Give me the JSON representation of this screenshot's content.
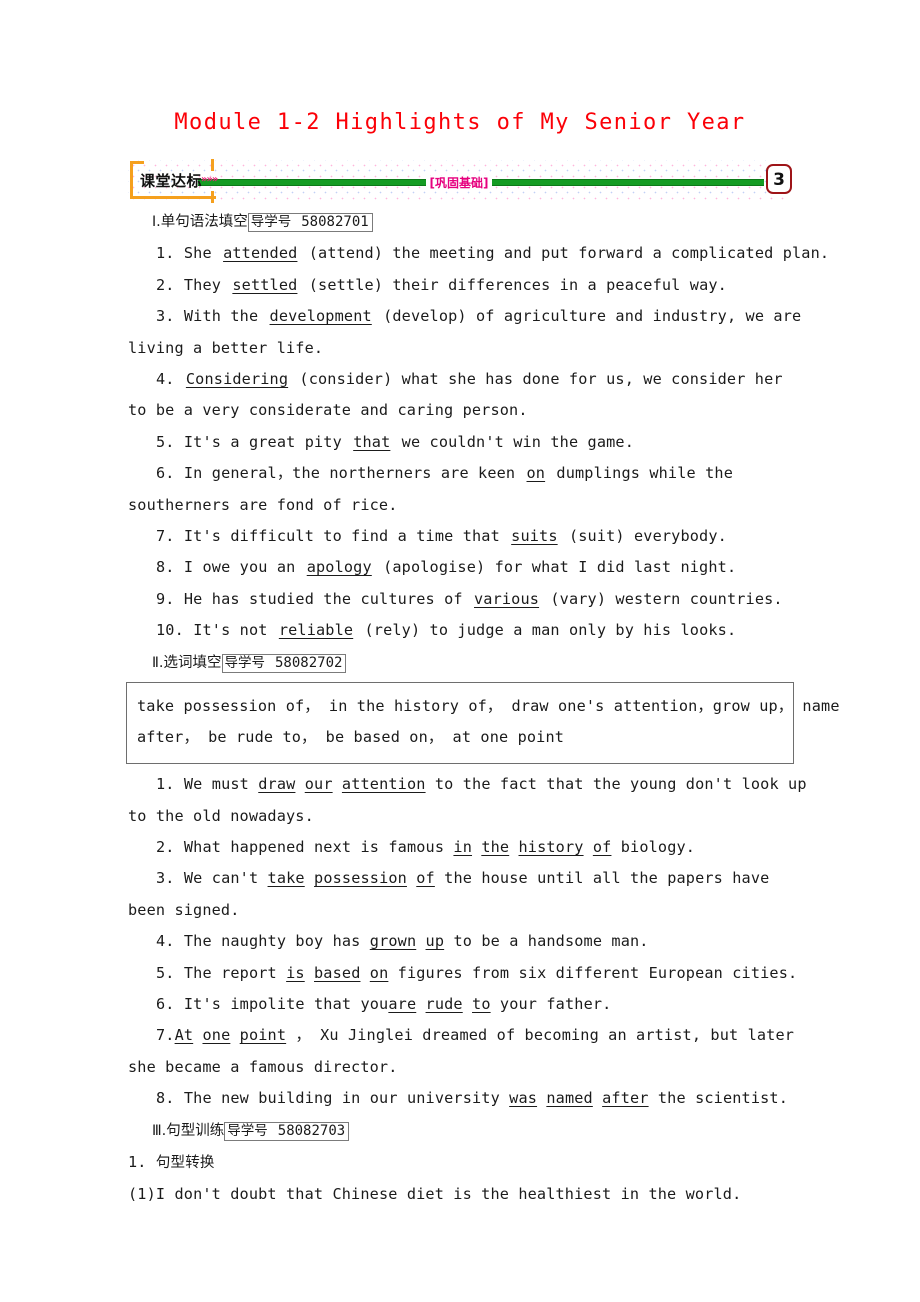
{
  "document": {
    "title": "Module 1-2 Highlights of My Senior Year",
    "title_color": "#fb0007"
  },
  "banner": {
    "label": "课堂达标",
    "chevrons": "»»»",
    "center_label": "[巩固基础]",
    "number": "3",
    "bracket_color": "#f5a01e",
    "rule_color": "#159c23",
    "center_color": "#e6007e",
    "number_border_color": "#9e1418"
  },
  "sections": [
    {
      "roman": "Ⅰ",
      "dot": ".",
      "name": "单句语法填空",
      "daoxue_label": "导学号",
      "daoxue_number": "58082701"
    },
    {
      "roman": "Ⅱ",
      "dot": ".",
      "name": "选词填空",
      "daoxue_label": "导学号",
      "daoxue_number": "58082702"
    },
    {
      "roman": "Ⅲ",
      "dot": ".",
      "name": "句型训练",
      "daoxue_label": "导学号",
      "daoxue_number": "58082703"
    }
  ],
  "part1": {
    "q1": {
      "num": "1.",
      "pre": "She",
      "answer": "attended",
      "post": "(attend) the meeting and put forward a complicated plan."
    },
    "q2": {
      "num": "2.",
      "pre": "They",
      "answer": "settled",
      "post": "(settle) their differences in a peaceful way."
    },
    "q3": {
      "num": "3.",
      "pre": "With the",
      "answer": "development",
      "post": "(develop) of agriculture and industry, we are living a better life."
    },
    "q4": {
      "num": "4.",
      "pre": "",
      "answer": "Considering",
      "post": "(consider) what she has done for us, we consider her to be a very considerate and caring person."
    },
    "q5": {
      "num": "5.",
      "pre": "It's a great pity",
      "answer": "that",
      "post": "we couldn't win the game."
    },
    "q6": {
      "num": "6.",
      "pre": "In general，the northerners are keen",
      "answer": "on",
      "post": "dumplings while the southerners are fond of rice."
    },
    "q7": {
      "num": "7.",
      "pre": "It's difficult to find a time that",
      "answer": "suits",
      "post": "(suit) everybody."
    },
    "q8": {
      "num": "8.",
      "pre": "I owe you an",
      "answer": "apology",
      "post": "(apologise) for what I did last night."
    },
    "q9": {
      "num": "9.",
      "pre": "He has studied the cultures of",
      "answer": "various",
      "post": "(vary) western countries."
    },
    "q10": {
      "num": "10.",
      "pre": "It's not",
      "answer": "reliable",
      "post": "(rely) to judge a man only by his looks."
    }
  },
  "wordbank": {
    "line1": "take possession of， in the history of， draw one's attention，grow up， name",
    "line2": "after， be rude to， be based on， at one point"
  },
  "part2": {
    "q1": {
      "num": "1.",
      "pre": "We must",
      "answer_words": [
        "draw",
        "our",
        "attention"
      ],
      "post": "to the fact that the young don't look up to the old nowadays."
    },
    "q2": {
      "num": "2.",
      "pre": "What happened next is famous",
      "answer_words": [
        "in",
        "the",
        "history",
        "of"
      ],
      "post": "biology."
    },
    "q3": {
      "num": "3.",
      "pre": "We can't",
      "answer_words": [
        "take",
        "possession",
        "of"
      ],
      "post": "the house until all the papers have been signed."
    },
    "q4": {
      "num": "4.",
      "pre": "The naughty boy has",
      "answer_words": [
        "grown",
        "up"
      ],
      "post": "to be a handsome man."
    },
    "q5": {
      "num": "5.",
      "pre": "The report",
      "answer_words": [
        "is",
        "based",
        "on"
      ],
      "post": "figures from six different European cities."
    },
    "q6": {
      "num": "6.",
      "pre": "It's impolite that you",
      "answer_words": [
        "are",
        "rude",
        "to"
      ],
      "post": "your father."
    },
    "q7": {
      "num": "7.",
      "pre": "",
      "answer_words": [
        "At",
        "one",
        "point"
      ],
      "post": "， Xu Jinglei dreamed of becoming an artist, but later she became a famous director."
    },
    "q8": {
      "num": "8.",
      "pre": "The new building in our university",
      "answer_words": [
        "was",
        "named",
        "after"
      ],
      "post": "the scientist."
    }
  },
  "part3": {
    "sub1_num": "1.",
    "sub1_name": "句型转换",
    "item1_num": "(1)",
    "item1_text": "I don't doubt that Chinese diet is the healthiest in the world."
  }
}
